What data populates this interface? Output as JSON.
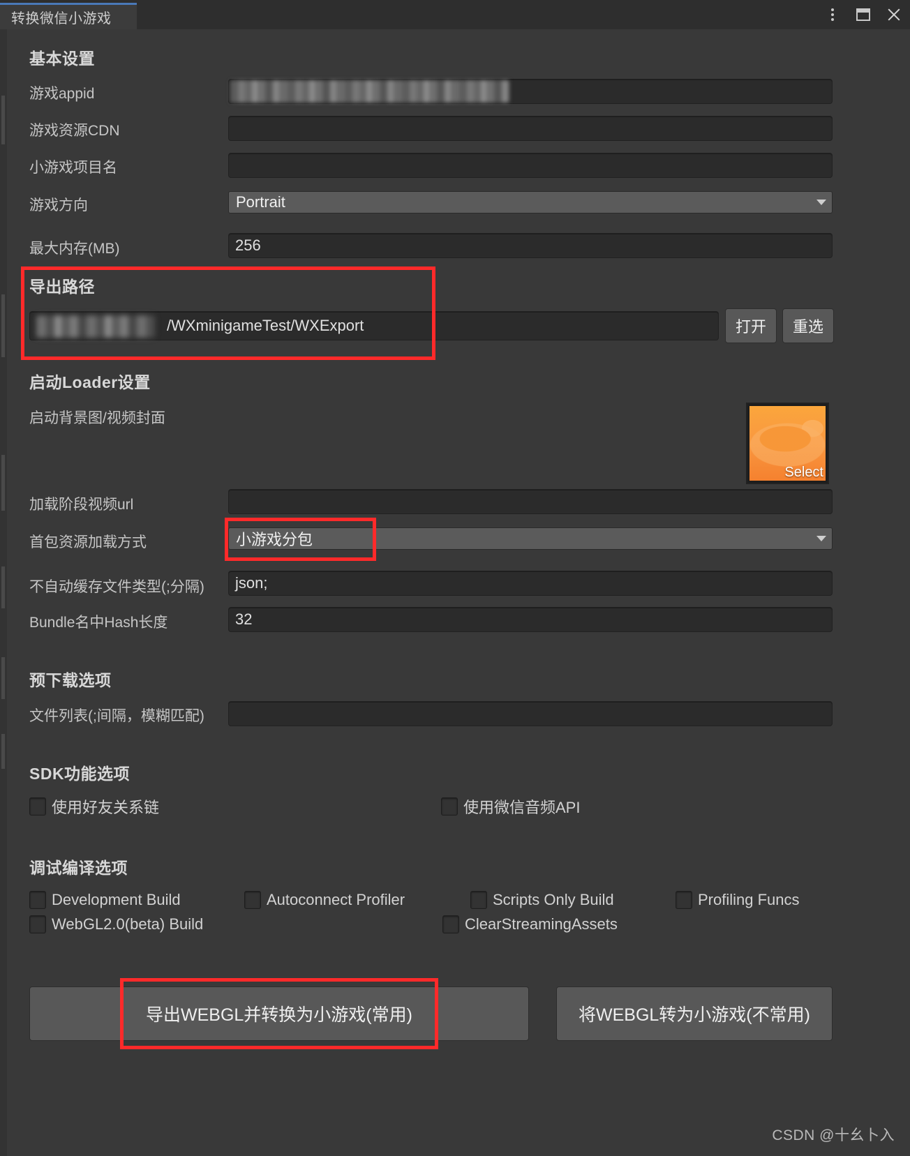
{
  "window": {
    "tab_label": "转换微信小游戏",
    "controls": {
      "menu": "vertical-dots-icon",
      "maximize": "maximize-icon",
      "close": "close-icon"
    }
  },
  "sections": {
    "basic": {
      "title": "基本设置",
      "fields": [
        {
          "label": "游戏appid",
          "value": "",
          "redacted": true,
          "type": "text"
        },
        {
          "label": "游戏资源CDN",
          "value": "",
          "type": "text"
        },
        {
          "label": "小游戏项目名",
          "value": "",
          "type": "text"
        },
        {
          "label": "游戏方向",
          "value": "Portrait",
          "type": "dropdown"
        },
        {
          "label": "最大内存(MB)",
          "value": "256",
          "type": "text"
        }
      ]
    },
    "export_path": {
      "title": "导出路径",
      "path_value": "/WXminigameTest/WXExport",
      "path_redacted": true,
      "open_button": "打开",
      "reselect_button": "重选"
    },
    "loader": {
      "title": "启动Loader设置",
      "bg_label": "启动背景图/视频封面",
      "thumbnail_select": "Select",
      "video_url_label": "加载阶段视频url",
      "video_url_value": "",
      "first_pack_label": "首包资源加载方式",
      "first_pack_value": "小游戏分包",
      "nocache_label": "不自动缓存文件类型(;分隔)",
      "nocache_value": "json;",
      "hash_label": "Bundle名中Hash长度",
      "hash_value": "32"
    },
    "predownload": {
      "title": "预下载选项",
      "filelist_label": "文件列表(;间隔，模糊匹配)",
      "filelist_value": ""
    },
    "sdk": {
      "title": "SDK功能选项",
      "options": [
        {
          "label": "使用好友关系链",
          "checked": false
        },
        {
          "label": "使用微信音频API",
          "checked": false
        }
      ]
    },
    "debug": {
      "title": "调试编译选项",
      "row1": [
        {
          "label": "Development Build",
          "checked": false
        },
        {
          "label": "Autoconnect Profiler",
          "checked": false
        },
        {
          "label": "Scripts Only Build",
          "checked": false
        },
        {
          "label": "Profiling Funcs",
          "checked": false
        }
      ],
      "row2": [
        {
          "label": "WebGL2.0(beta) Build",
          "checked": false
        },
        {
          "label": "ClearStreamingAssets",
          "checked": false
        }
      ]
    }
  },
  "actions": {
    "primary": "导出WEBGL并转换为小游戏(常用)",
    "secondary": "将WEBGL转为小游戏(不常用)"
  },
  "watermark": "CSDN @十幺卜入",
  "colors": {
    "accent": "#4a79b8",
    "highlight": "#ff2a2a",
    "background": "#393939",
    "field": "#2b2b2b"
  }
}
